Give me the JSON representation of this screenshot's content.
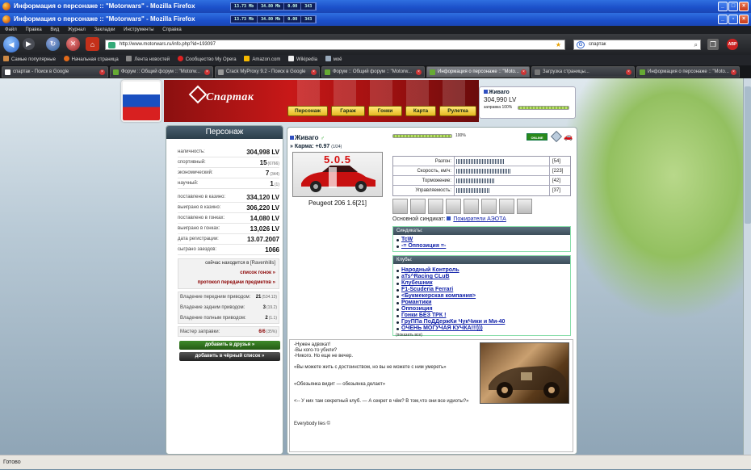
{
  "window": {
    "title": "Информация о персонаже :: \"Motorwars\" - Mozilla Firefox",
    "sysmon": [
      "13.73 Mb",
      "34.80 Mb",
      "0.00",
      "343"
    ]
  },
  "menu": [
    "Файл",
    "Правка",
    "Вид",
    "Журнал",
    "Закладки",
    "Инструменты",
    "Справка"
  ],
  "nav": {
    "url": "http://www.motorwars.ru/info.php?id=193097",
    "search_value": "спартак"
  },
  "bookmarks": [
    "Самые популярные",
    "Начальная страница",
    "Лента новостей",
    "Сообщество My Opera",
    "Amazon.com",
    "Wikipedia",
    "моё"
  ],
  "tabs": [
    "спартак - Поиск в Google",
    "Форум :: Общий форум :: \"Motorw...",
    "Crack MyProxy 9.2 - Поиск в Google",
    "Форум :: Общий форум :: \"Motorw...",
    "Информация о персонаже :: \"Moto...",
    "Загрузка страницы...",
    "Информация о персонаже :: \"Moto..."
  ],
  "site": {
    "logo_text": "Спартак",
    "nav_buttons": [
      "Персонаж",
      "Гараж",
      "Гонки",
      "Карта",
      "Рулетка"
    ],
    "user": {
      "nick": "Живаго",
      "money": "304,990 LV",
      "refuel_label": "заправка 100%",
      "refuel": 100
    }
  },
  "sidebar": {
    "title": "Персонаж",
    "money": [
      {
        "label": "наличность:",
        "value": "304,998 LV"
      },
      {
        "label": "спортивный:",
        "value": "15",
        "sub": "(6766)"
      },
      {
        "label": "экономический:",
        "value": "7",
        "sub": "(344)"
      },
      {
        "label": "научный:",
        "value": "1",
        "sub": "(1)"
      }
    ],
    "casino": [
      {
        "label": "поставлено в казино:",
        "value": "334,120 LV"
      },
      {
        "label": "выиграно в казино:",
        "value": "306,220 LV"
      },
      {
        "label": "поставлено в гонках:",
        "value": "14,080 LV"
      },
      {
        "label": "выиграно в гонках:",
        "value": "13,026 LV"
      },
      {
        "label": "дата регистрации:",
        "value": "13.07.2007"
      },
      {
        "label": "сыграно заездов:",
        "value": "1066"
      }
    ],
    "location_prefix": "сейчас находится в",
    "location": "[Ravenhills]",
    "links": [
      "список гонок »",
      "протокол передачи предметов »"
    ],
    "drive": [
      {
        "label": "Владение передним приводом:",
        "value": "21",
        "sub": "(534.13)"
      },
      {
        "label": "Владение задним приводом:",
        "value": "3",
        "sub": "(19.2)"
      },
      {
        "label": "Владение полным приводом:",
        "value": "2",
        "sub": "(1.1)"
      }
    ],
    "refuel_master": {
      "label": "Мастер заправки:",
      "value": "6/6",
      "sub": "(35%)"
    },
    "buttons": [
      "добавить в друзья »",
      "добавить в чёрный список »"
    ]
  },
  "profile": {
    "nick": "Живаго",
    "karma_label": "» Карма:",
    "karma": "+0.97",
    "karma_sub": "(1/24)",
    "progress_label": "100%",
    "progress": 100,
    "online_badge": "ONLINE",
    "car_number": "5.0.5",
    "car_name": "Peugeot 206 1.6[21]",
    "stats": [
      {
        "label": "Разгон:",
        "value": "[54]",
        "level": 54
      },
      {
        "label": "Скорость, км/ч:",
        "value": "[223]",
        "level": 60
      },
      {
        "label": "Торможение:",
        "value": "[42]",
        "level": 42
      },
      {
        "label": "Управляемость:",
        "value": "[37]",
        "level": 37
      }
    ],
    "syndicate_label": "Основной синдикат:",
    "syndicate": "Пожиратели АЭОТА",
    "syndicates_title": "Синдикаты:",
    "syndicates": [
      "TcW",
      "-= Оппозиция =-"
    ],
    "clubs_title": "Клубы:",
    "clubs": [
      "Народный Контроль",
      "aTs^Racing CLuB",
      "Клубешник",
      "F1-Scuderia Ferrari",
      "<Букмекерская компания>",
      "Романтики",
      "Оппозиция",
      "Гонки БЕЗ ТРК !",
      "ГруППа ПоДДержКи ЧукЧики и Ми-40",
      "ОЧЕНЬ МОГУЧАЯ КУЧКА!!!)))"
    ],
    "show_all": "(показать все)"
  },
  "about": [
    "-Нужен адвокат!",
    "-Вы кого-то убили?",
    "-Никого. Но еще не вечер.",
    "",
    "«Вы можете жить с достоинством, но вы не можете с ним умереть»",
    "",
    "",
    "«Обезьянка видит — обезьянка делает»",
    "",
    "",
    "<-- У них там секретный клуб. — А секрет в чём? В том,что они все идиоты?»",
    "",
    "",
    "",
    "Everybody lies ©"
  ],
  "status": "Готово"
}
